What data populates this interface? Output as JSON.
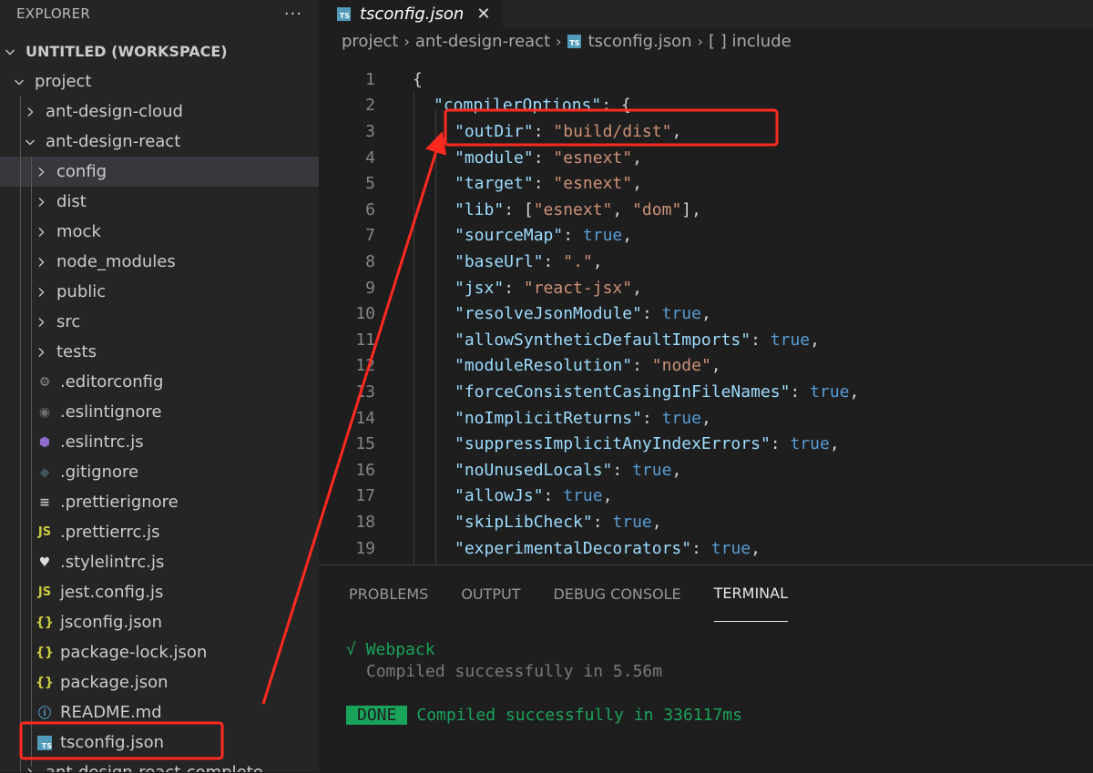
{
  "explorer": {
    "title": "EXPLORER",
    "more_label": "···",
    "workspace": "UNTITLED (WORKSPACE)",
    "folders": {
      "project": "project",
      "cloud": "ant-design-cloud",
      "react": "ant-design-react",
      "react_complete": "ant-design-react-complete"
    },
    "subfolders": [
      "config",
      "dist",
      "mock",
      "node_modules",
      "public",
      "src",
      "tests"
    ],
    "files": [
      {
        "name": ".editorconfig",
        "icon": "gear-icon",
        "glyph": "⚙",
        "color": "#8a8a8a"
      },
      {
        "name": ".eslintignore",
        "icon": "circle-icon",
        "glyph": "◉",
        "color": "#6d6d6d"
      },
      {
        "name": ".eslintrc.js",
        "icon": "eslint-icon",
        "glyph": "⬢",
        "color": "#8e6bcc"
      },
      {
        "name": ".gitignore",
        "icon": "git-icon",
        "glyph": "◆",
        "color": "#41535b"
      },
      {
        "name": ".prettierignore",
        "icon": "lines-icon",
        "glyph": "≡",
        "color": "#c5c5c5"
      },
      {
        "name": ".prettierrc.js",
        "icon": "js-icon",
        "glyph": "JS",
        "color": "#cbcb41"
      },
      {
        "name": ".stylelintrc.js",
        "icon": "stylelint-icon",
        "glyph": "♥",
        "color": "#dddddd"
      },
      {
        "name": "jest.config.js",
        "icon": "js-icon",
        "glyph": "JS",
        "color": "#cbcb41"
      },
      {
        "name": "jsconfig.json",
        "icon": "json-icon",
        "glyph": "{}",
        "color": "#cbcb41"
      },
      {
        "name": "package-lock.json",
        "icon": "json-icon",
        "glyph": "{}",
        "color": "#cbcb41"
      },
      {
        "name": "package.json",
        "icon": "json-icon",
        "glyph": "{}",
        "color": "#cbcb41"
      },
      {
        "name": "README.md",
        "icon": "info-icon",
        "glyph": "ⓘ",
        "color": "#519aba"
      },
      {
        "name": "tsconfig.json",
        "icon": "ts-icon",
        "glyph": "TS",
        "color": "#519aba"
      }
    ]
  },
  "editor": {
    "tab": "tsconfig.json",
    "tab_icon": "TS",
    "close_label": "✕",
    "breadcrumbs": [
      "project",
      "ant-design-react",
      "tsconfig.json",
      "[ ] include"
    ],
    "lines": [
      {
        "n": "1",
        "indent": 0,
        "parts": [
          [
            "p",
            "{"
          ]
        ]
      },
      {
        "n": "2",
        "indent": 1,
        "parts": [
          [
            "k",
            "\"compilerOptions\""
          ],
          [
            "p",
            ": {"
          ]
        ]
      },
      {
        "n": "3",
        "indent": 2,
        "parts": [
          [
            "k",
            "\"outDir\""
          ],
          [
            "p",
            ": "
          ],
          [
            "s",
            "\"build/dist\""
          ],
          [
            "p",
            ","
          ]
        ]
      },
      {
        "n": "4",
        "indent": 2,
        "parts": [
          [
            "k",
            "\"module\""
          ],
          [
            "p",
            ": "
          ],
          [
            "s",
            "\"esnext\""
          ],
          [
            "p",
            ","
          ]
        ]
      },
      {
        "n": "5",
        "indent": 2,
        "parts": [
          [
            "k",
            "\"target\""
          ],
          [
            "p",
            ": "
          ],
          [
            "s",
            "\"esnext\""
          ],
          [
            "p",
            ","
          ]
        ]
      },
      {
        "n": "6",
        "indent": 2,
        "parts": [
          [
            "k",
            "\"lib\""
          ],
          [
            "p",
            ": ["
          ],
          [
            "s",
            "\"esnext\""
          ],
          [
            "p",
            ", "
          ],
          [
            "s",
            "\"dom\""
          ],
          [
            "p",
            "],"
          ]
        ]
      },
      {
        "n": "7",
        "indent": 2,
        "parts": [
          [
            "k",
            "\"sourceMap\""
          ],
          [
            "p",
            ": "
          ],
          [
            "b",
            "true"
          ],
          [
            "p",
            ","
          ]
        ]
      },
      {
        "n": "8",
        "indent": 2,
        "parts": [
          [
            "k",
            "\"baseUrl\""
          ],
          [
            "p",
            ": "
          ],
          [
            "s",
            "\".\""
          ],
          [
            "p",
            ","
          ]
        ]
      },
      {
        "n": "9",
        "indent": 2,
        "parts": [
          [
            "k",
            "\"jsx\""
          ],
          [
            "p",
            ": "
          ],
          [
            "s",
            "\"react-jsx\""
          ],
          [
            "p",
            ","
          ]
        ]
      },
      {
        "n": "10",
        "indent": 2,
        "parts": [
          [
            "k",
            "\"resolveJsonModule\""
          ],
          [
            "p",
            ": "
          ],
          [
            "b",
            "true"
          ],
          [
            "p",
            ","
          ]
        ]
      },
      {
        "n": "11",
        "indent": 2,
        "parts": [
          [
            "k",
            "\"allowSyntheticDefaultImports\""
          ],
          [
            "p",
            ": "
          ],
          [
            "b",
            "true"
          ],
          [
            "p",
            ","
          ]
        ]
      },
      {
        "n": "12",
        "indent": 2,
        "parts": [
          [
            "k",
            "\"moduleResolution\""
          ],
          [
            "p",
            ": "
          ],
          [
            "s",
            "\"node\""
          ],
          [
            "p",
            ","
          ]
        ]
      },
      {
        "n": "13",
        "indent": 2,
        "parts": [
          [
            "k",
            "\"forceConsistentCasingInFileNames\""
          ],
          [
            "p",
            ": "
          ],
          [
            "b",
            "true"
          ],
          [
            "p",
            ","
          ]
        ]
      },
      {
        "n": "14",
        "indent": 2,
        "parts": [
          [
            "k",
            "\"noImplicitReturns\""
          ],
          [
            "p",
            ": "
          ],
          [
            "b",
            "true"
          ],
          [
            "p",
            ","
          ]
        ]
      },
      {
        "n": "15",
        "indent": 2,
        "parts": [
          [
            "k",
            "\"suppressImplicitAnyIndexErrors\""
          ],
          [
            "p",
            ": "
          ],
          [
            "b",
            "true"
          ],
          [
            "p",
            ","
          ]
        ]
      },
      {
        "n": "16",
        "indent": 2,
        "parts": [
          [
            "k",
            "\"noUnusedLocals\""
          ],
          [
            "p",
            ": "
          ],
          [
            "b",
            "true"
          ],
          [
            "p",
            ","
          ]
        ]
      },
      {
        "n": "17",
        "indent": 2,
        "parts": [
          [
            "k",
            "\"allowJs\""
          ],
          [
            "p",
            ": "
          ],
          [
            "b",
            "true"
          ],
          [
            "p",
            ","
          ]
        ]
      },
      {
        "n": "18",
        "indent": 2,
        "parts": [
          [
            "k",
            "\"skipLibCheck\""
          ],
          [
            "p",
            ": "
          ],
          [
            "b",
            "true"
          ],
          [
            "p",
            ","
          ]
        ]
      },
      {
        "n": "19",
        "indent": 2,
        "parts": [
          [
            "k",
            "\"experimentalDecorators\""
          ],
          [
            "p",
            ": "
          ],
          [
            "b",
            "true"
          ],
          [
            "p",
            ","
          ]
        ]
      }
    ]
  },
  "panel": {
    "tabs": [
      "PROBLEMS",
      "OUTPUT",
      "DEBUG CONSOLE",
      "TERMINAL"
    ],
    "active_tab": "TERMINAL",
    "terminal": {
      "check": "√",
      "webpack": "Webpack",
      "compiled": "Compiled successfully in 5.56m",
      "done_badge": "DONE",
      "done_text": "Compiled successfully in 336117ms"
    }
  },
  "colors": {
    "annotation": "#ff2a1f",
    "key": "#9cdcfe",
    "string": "#ce9178",
    "boolean": "#569cd6",
    "success": "#1aa35b"
  }
}
